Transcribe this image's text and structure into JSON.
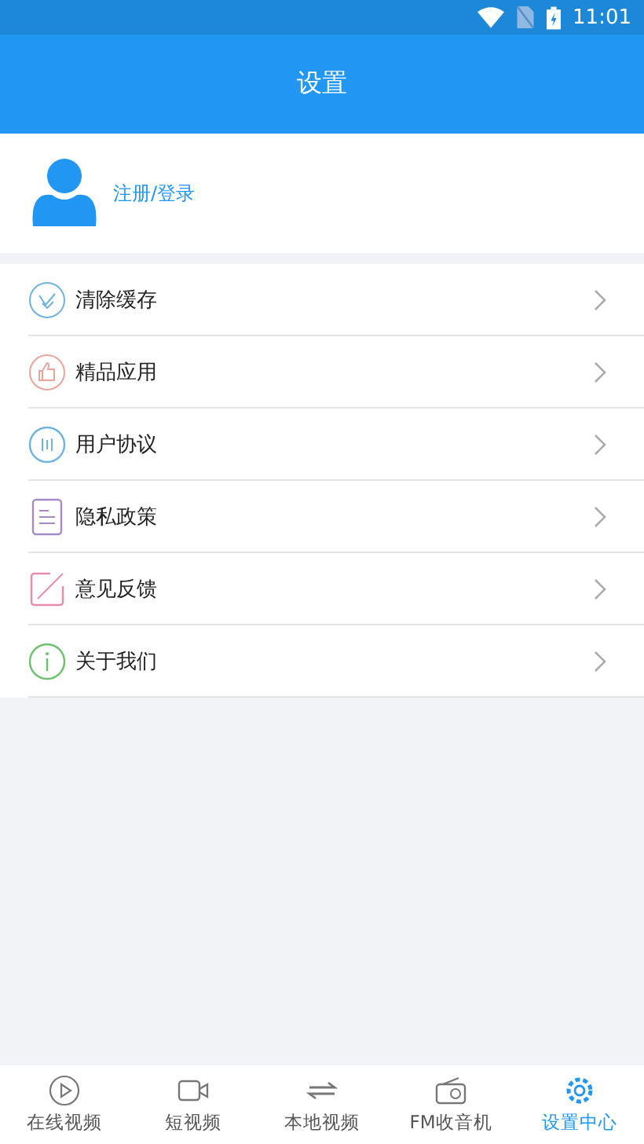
{
  "status_bar": {
    "time": "11:01"
  },
  "header": {
    "title": "设置"
  },
  "profile": {
    "label": "注册/登录"
  },
  "menu": [
    {
      "label": "清除缓存"
    },
    {
      "label": "精品应用"
    },
    {
      "label": "用户协议"
    },
    {
      "label": "隐私政策"
    },
    {
      "label": "意见反馈"
    },
    {
      "label": "关于我们"
    }
  ],
  "tabs": [
    {
      "label": "在线视频",
      "selected": false
    },
    {
      "label": "短视频",
      "selected": false
    },
    {
      "label": "本地视频",
      "selected": false
    },
    {
      "label": "FM收音机",
      "selected": false
    },
    {
      "label": "设置中心",
      "selected": true
    }
  ]
}
